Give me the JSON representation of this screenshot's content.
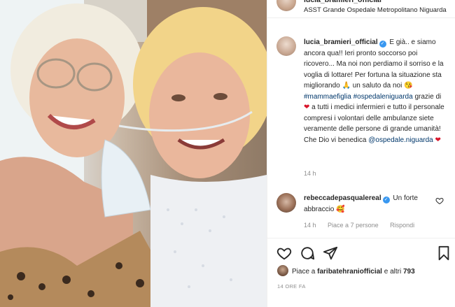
{
  "post": {
    "author": "lucia_bramieri_official",
    "location": "ASST Grande Ospedale Metropolitano Niguarda",
    "caption": {
      "username": "lucia_bramieri_official",
      "segments": [
        " E già.. e siamo ancora qua!! Ieri pronto soccorso poi ricovero... Ma noi non perdiamo il sorriso e la voglia di lottare! Per fortuna la situazione sta migliorando 🙏 un saluto da noi 😘 ",
        "#mammaefiglia",
        " ",
        "#ospedaleniguarda",
        " grazie di ",
        "❤",
        " a tutti i medici infermieri e tutto il personale compresi i volontari delle ambulanze siete veramente delle persone di grande umanità! Che Dio vi benedica ",
        "@ospedale.niguarda",
        " ",
        "❤"
      ],
      "time": "14 h"
    },
    "comment": {
      "username": "rebeccadepasqualereal",
      "text": " Un forte abbraccio 🥰",
      "time": "14 h",
      "likes": "Piace a 7 persone",
      "reply": "Rispondi"
    },
    "likes": {
      "prefix": "Piace a ",
      "user": "faribatehraniofficial",
      "middle": " e altri ",
      "count": "793"
    },
    "date": "14 ORE FA"
  },
  "icons": {
    "verified": "verified-badge-icon",
    "like": "heart-icon",
    "comment": "comment-bubble-icon",
    "share": "paper-plane-icon",
    "save": "bookmark-icon"
  },
  "colors": {
    "link": "#00376b",
    "verified": "#3897f0",
    "heart": "#d8152a",
    "secondary_text": "#8e8e8e",
    "border": "#efefef"
  }
}
